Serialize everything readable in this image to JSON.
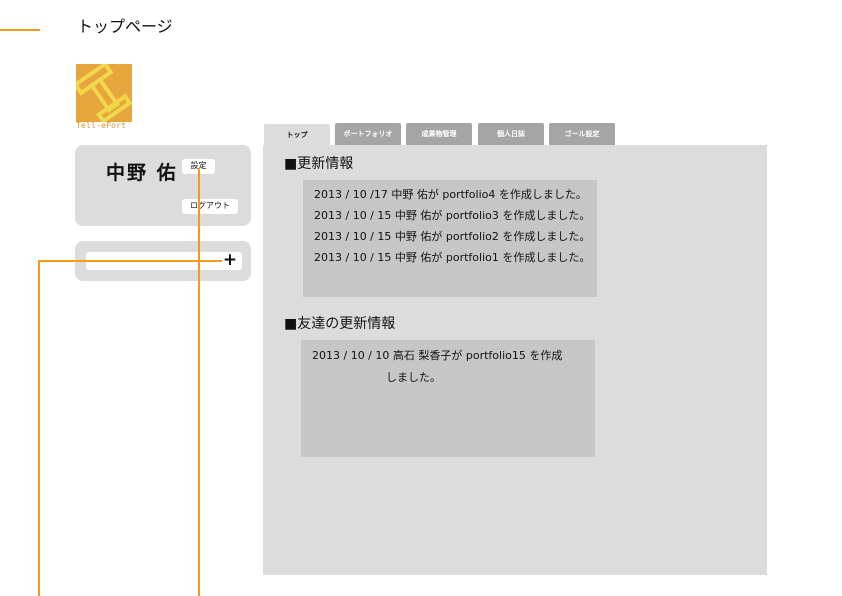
{
  "header": {
    "title": "トップページ"
  },
  "logo": {
    "text": "Tell-ePort",
    "colors": {
      "background": "#e7a63d",
      "mark": "#f0d84a"
    }
  },
  "profile": {
    "name": "中野 佑",
    "settings_label": "設定",
    "logout_label": "ログアウト"
  },
  "add_panel": {
    "plus_symbol": "+"
  },
  "tabs": [
    {
      "label": "トップ",
      "active": true
    },
    {
      "label": "ポートフォリオ",
      "active": false
    },
    {
      "label": "成果物管理",
      "active": false
    },
    {
      "label": "個人日誌",
      "active": false
    },
    {
      "label": "ゴール設定",
      "active": false
    }
  ],
  "updates": {
    "title": "■更新情報",
    "items": [
      "2013 / 10 /17  中野 佑が portfolio4 を作成しました。",
      "2013 / 10 / 15 中野 佑が portfolio3 を作成しました。",
      "2013 / 10 / 15 中野 佑が portfolio2 を作成しました。",
      "2013 / 10 / 15 中野 佑が portfolio1 を作成しました。"
    ]
  },
  "friend_updates": {
    "title": "■友達の更新情報",
    "items": [
      "2013 / 10 / 10 高石 梨香子が portfolio15 を作成",
      "しました。"
    ]
  },
  "colors": {
    "accent": "#f29a1a",
    "panel": "#dcdcdc",
    "box": "#c6c6c6",
    "tab_inactive": "#a5a5a5"
  }
}
